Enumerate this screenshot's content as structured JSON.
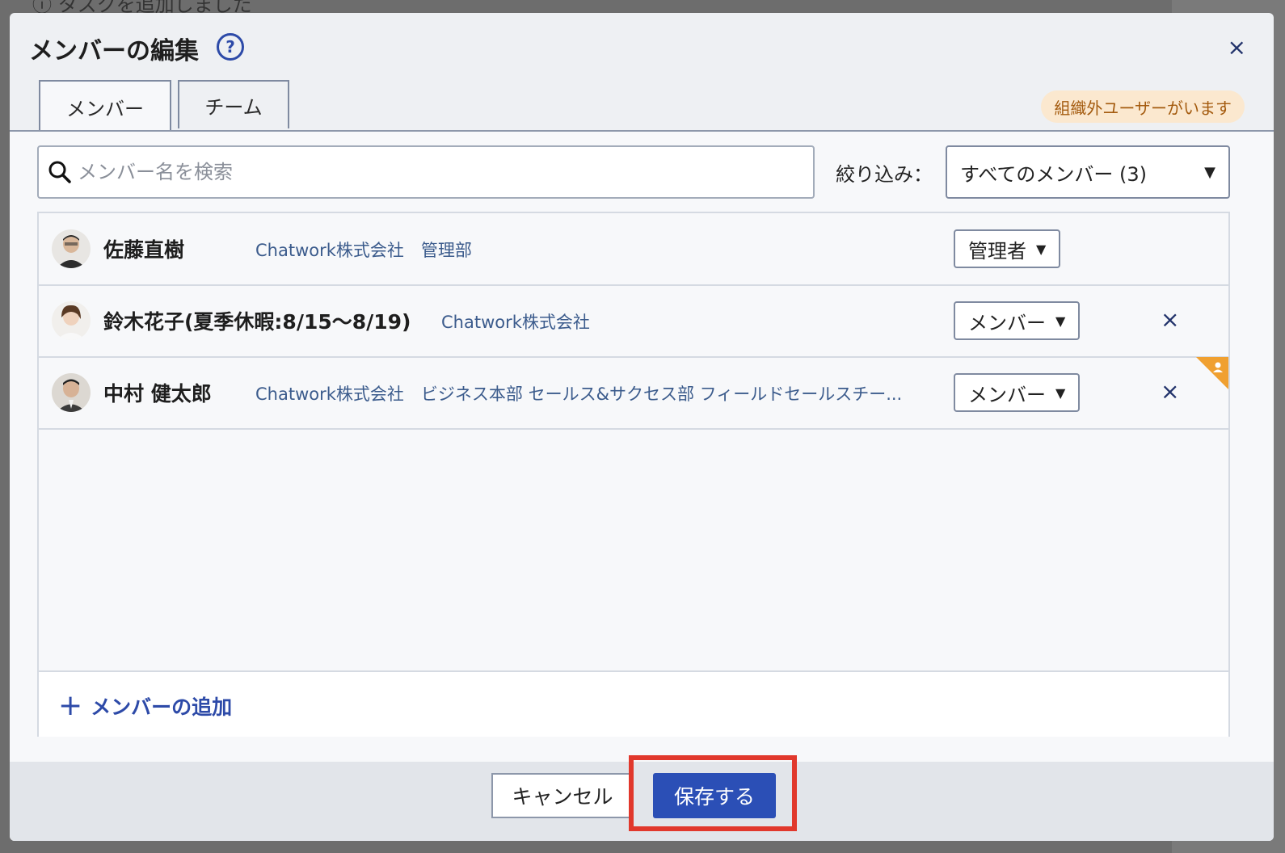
{
  "background": {
    "toast_text": "タスクを追加しました"
  },
  "modal": {
    "title": "メンバーの編集",
    "help_icon": "?",
    "close_icon": "×",
    "tabs": [
      {
        "label": "メンバー",
        "active": true
      },
      {
        "label": "チーム",
        "active": false
      }
    ],
    "badge": "組織外ユーザーがいます",
    "search": {
      "placeholder": "メンバー名を検索",
      "value": ""
    },
    "filter": {
      "label": "絞り込み：",
      "value": "すべてのメンバー (3)",
      "caret": "▼"
    },
    "members": [
      {
        "name": "佐藤直樹",
        "org": "Chatwork株式会社　管理部",
        "role": "管理者",
        "removable": false
      },
      {
        "name": "鈴木花子(夏季休暇:8/15〜8/19)",
        "org": "Chatwork株式会社",
        "role": "メンバー",
        "removable": true
      },
      {
        "name": "中村 健太郎",
        "org": "Chatwork株式会社　ビジネス本部 セールス&サクセス部 フィールドセールスチー...",
        "role": "メンバー",
        "removable": true,
        "external_marker": true
      }
    ],
    "role_caret": "▼",
    "remove_icon": "×",
    "add_member": {
      "label": "メンバーの追加",
      "icon": "+"
    },
    "footer": {
      "cancel_label": "キャンセル",
      "save_label": "保存する"
    }
  },
  "colors": {
    "primary": "#2b4fb6",
    "badge_bg": "#fbe8cf",
    "badge_text": "#a45b0f",
    "highlight": "#e1382c",
    "external_marker": "#f0a030"
  }
}
